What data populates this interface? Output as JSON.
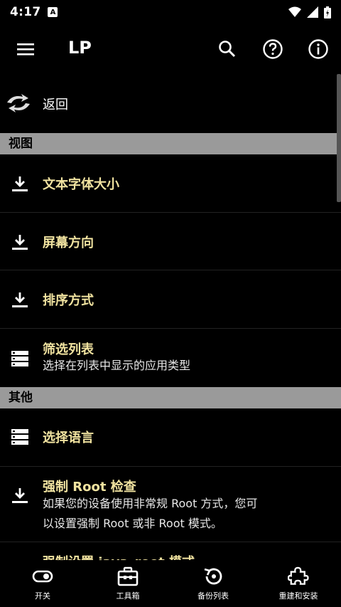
{
  "status_bar": {
    "time": "4:17",
    "notification_icon": "A"
  },
  "app_bar": {
    "title": "LP",
    "icons": [
      "menu-icon",
      "search-icon",
      "help-icon",
      "info-icon"
    ]
  },
  "list": {
    "back": {
      "label": "返回"
    },
    "section_view": "视图",
    "font_size": {
      "title": "文本字体大小"
    },
    "screen_orientation": {
      "title": "屏幕方向"
    },
    "sort_mode": {
      "title": "排序方式"
    },
    "filter_list": {
      "title": "筛选列表",
      "subtitle": "选择在列表中显示的应用类型"
    },
    "section_other": "其他",
    "language": {
      "title": "选择语言"
    },
    "force_root": {
      "title": "强制 Root 检查",
      "subtitle_line1": "如果您的设备使用非常规 Root 方式，您可",
      "subtitle_line2": "以设置强制 Root 或非 Root 模式。"
    },
    "force_java_root": {
      "title": "强制设置 java_root 模式"
    }
  },
  "bottom_nav": {
    "items": [
      {
        "label": "开关",
        "icon": "toggle-icon"
      },
      {
        "label": "工具箱",
        "icon": "toolbox-icon"
      },
      {
        "label": "备份列表",
        "icon": "backup-icon"
      },
      {
        "label": "重建和安装",
        "icon": "puzzle-icon"
      }
    ]
  },
  "colors": {
    "accent_text": "#f1e3a0",
    "section_bg": "#9a9a9a",
    "background": "#000000"
  }
}
